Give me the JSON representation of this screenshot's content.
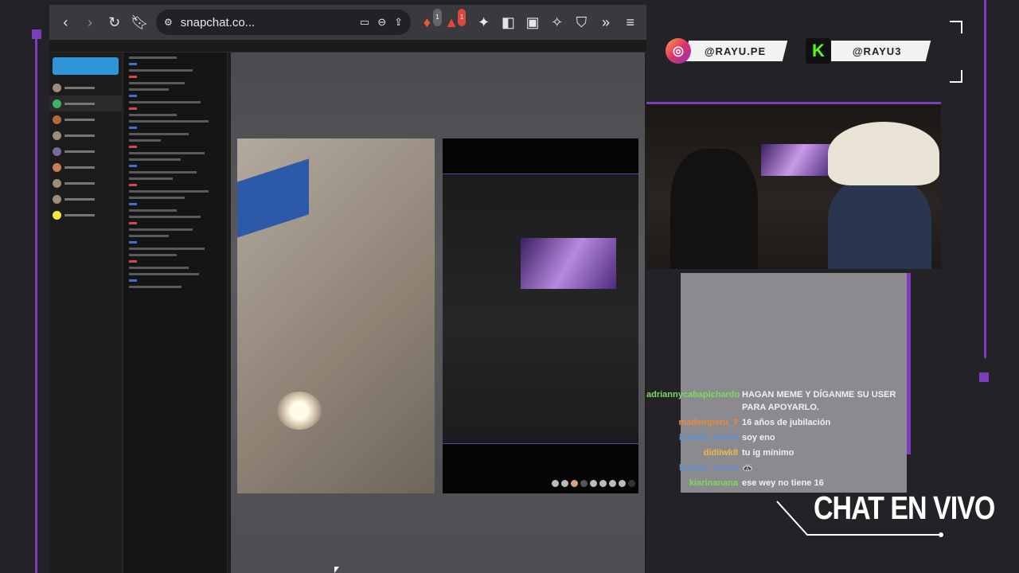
{
  "browser": {
    "url": "snapchat.co...",
    "shields_count": "1",
    "rewards_count": "1"
  },
  "socials": [
    {
      "icon": "instagram-icon",
      "handle": "@RAYU.PE",
      "color": "#e1306c"
    },
    {
      "icon": "kick-icon",
      "handle": "@RAYU3",
      "color": "#53fc18"
    }
  ],
  "chat": {
    "title": "CHAT EN VIVO",
    "messages": [
      {
        "user": "adriannycabapichardo",
        "text": "HAGAN MEME Y DÍGANME SU USER PARA APOYARLO.",
        "color": "#7ddc5a"
      },
      {
        "user": "madeinperu_7",
        "text": "16 años de jubilación",
        "color": "#e88a3c"
      },
      {
        "user": "broken_seven",
        "text": "soy eno",
        "color": "#5b8fd8"
      },
      {
        "user": "didiiwk8",
        "text": "tu ig mínimo",
        "color": "#f0b84a"
      },
      {
        "user": "broken_seven",
        "text": "🦝",
        "color": "#5b8fd8"
      },
      {
        "user": "kiarinanana",
        "text": "ese wey no tiene 16",
        "color": "#7ddc5a"
      }
    ]
  },
  "colors": {
    "accent": "#7a3fb8",
    "snap_blue": "#2f95d8"
  }
}
